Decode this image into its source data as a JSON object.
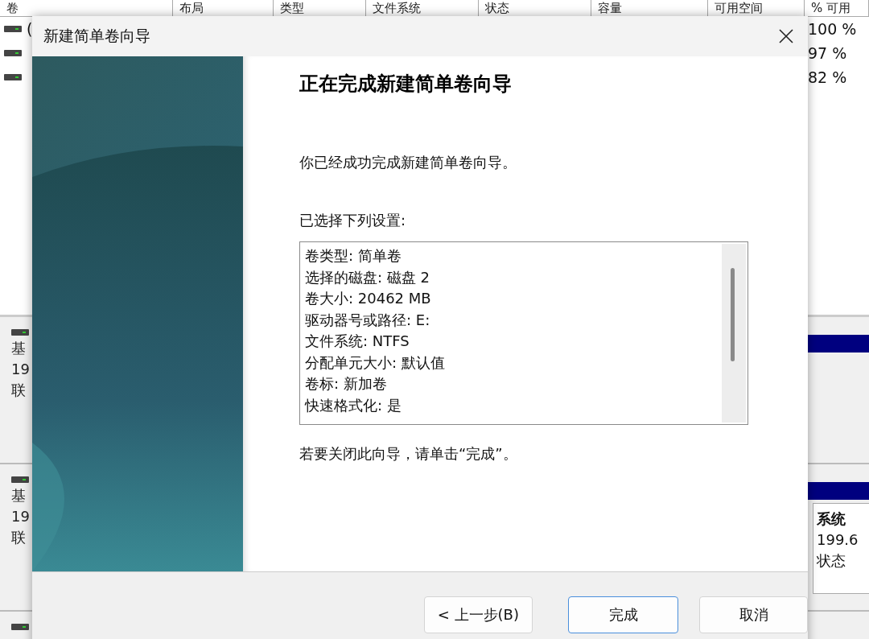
{
  "background_window": {
    "columns": [
      "卷",
      "布局",
      "类型",
      "文件系统",
      "状态",
      "容量",
      "可用空间",
      "% 可用"
    ],
    "volumes": [
      {
        "name": "(",
        "free_pct": "100 %"
      },
      {
        "free_pct": "97 %"
      },
      {
        "free_pct": "82 %"
      }
    ],
    "disks": [
      {
        "kind": "disk",
        "lines": [
          "基",
          "19",
          "联"
        ]
      },
      {
        "kind": "disk",
        "lines": [
          "基",
          "19",
          "联"
        ],
        "partition": {
          "name": "系统",
          "size": "199.6",
          "status": "状态"
        }
      },
      {
        "kind": "disk"
      }
    ]
  },
  "wizard": {
    "title": "新建简单卷向导",
    "heading": "正在完成新建简单卷向导",
    "intro": "你已经成功完成新建简单卷向导。",
    "settings_label": "已选择下列设置:",
    "settings": [
      "卷类型: 简单卷",
      "选择的磁盘: 磁盘 2",
      "卷大小: 20462 MB",
      "驱动器号或路径: E:",
      "文件系统: NTFS",
      "分配单元大小: 默认值",
      "卷标: 新加卷",
      "快速格式化: 是"
    ],
    "close_hint": "若要关闭此向导，请单击“完成”。",
    "buttons": [
      {
        "label": "< 上一步(B)",
        "default": false
      },
      {
        "label": "完成",
        "default": true
      },
      {
        "label": "取消",
        "default": false
      }
    ]
  }
}
